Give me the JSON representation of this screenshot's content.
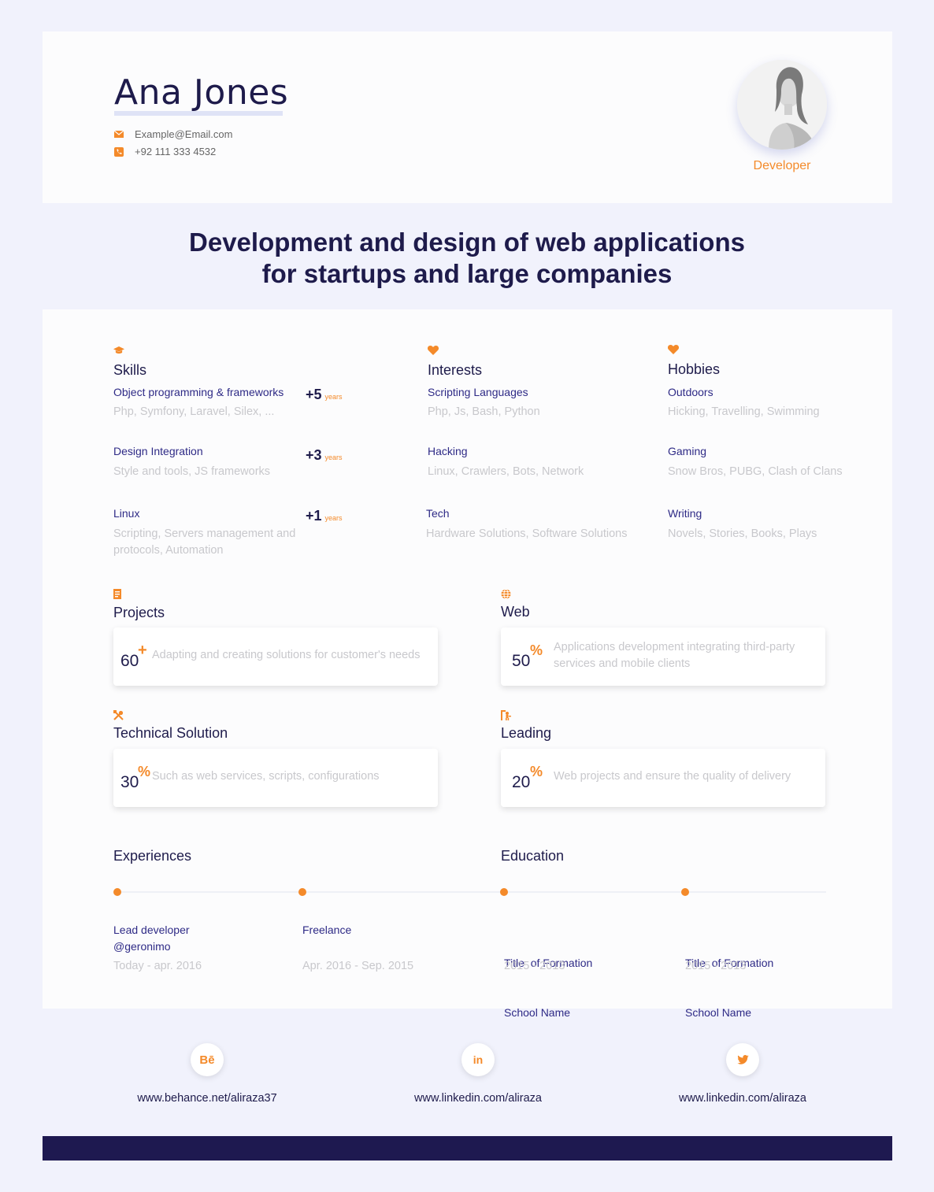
{
  "profile": {
    "name": "Ana Jones",
    "email": "Example@Email.com",
    "phone": "+92 111 333 4532",
    "role": "Developer"
  },
  "tagline": {
    "line1": "Development and design of web applications",
    "line2": "for startups and large companies"
  },
  "skills": {
    "title": "Skills",
    "items": [
      {
        "title": "Object programming & frameworks",
        "desc": "Php, Symfony, Laravel, Silex, ...",
        "years": "+5",
        "years_label": "years"
      },
      {
        "title": "Design Integration",
        "desc": "Style and tools, JS frameworks",
        "years": "+3",
        "years_label": "years"
      },
      {
        "title": "Linux",
        "desc": "Scripting, Servers management and protocols, Automation",
        "years": "+1",
        "years_label": "years"
      }
    ]
  },
  "interests": {
    "title": "Interests",
    "items": [
      {
        "title": "Scripting Languages",
        "desc": "Php, Js, Bash, Python"
      },
      {
        "title": "Hacking",
        "desc": "Linux, Crawlers, Bots, Network"
      },
      {
        "title": "Tech",
        "desc": "Hardware Solutions, Software Solutions"
      }
    ]
  },
  "hobbies": {
    "title": "Hobbies",
    "items": [
      {
        "title": "Outdoors",
        "desc": "Hicking, Travelling, Swimming"
      },
      {
        "title": "Gaming",
        "desc": "Snow Bros, PUBG, Clash of Clans"
      },
      {
        "title": "Writing",
        "desc": "Novels, Stories, Books, Plays"
      }
    ]
  },
  "stats": [
    {
      "title": "Projects",
      "value": "60",
      "symbol": "+",
      "text": "Adapting and creating solutions for customer's needs"
    },
    {
      "title": "Web",
      "value": "50",
      "symbol": "%",
      "text": "Applications development integrating third-party services and mobile clients"
    },
    {
      "title": "Technical Solution",
      "value": "30",
      "symbol": "%",
      "text": "Such as web services, scripts, configurations"
    },
    {
      "title": "Leading",
      "value": "20",
      "symbol": "%",
      "text": "Web projects and ensure the quality of delivery"
    }
  ],
  "experiences": {
    "title": "Experiences",
    "items": [
      {
        "line1": "Lead developer",
        "line2": "@geronimo",
        "date": "Today - apr. 2016"
      },
      {
        "line1": "Freelance",
        "line2": "",
        "date": "Apr. 2016 - Sep. 2015"
      }
    ]
  },
  "education": {
    "title": "Education",
    "items": [
      {
        "line1": "Title  of Formation",
        "line2": "School Name",
        "date": "2015 - 2013"
      },
      {
        "line1": "Title  of Formation",
        "line2": "School Name",
        "date": "2015 - 2013"
      }
    ]
  },
  "social": [
    {
      "icon": "behance-icon",
      "glyph": "Bē",
      "url": "www.behance.net/aliraza37"
    },
    {
      "icon": "linkedin-icon",
      "glyph": "in",
      "url": "www.linkedin.com/aliraza"
    },
    {
      "icon": "twitter-icon",
      "glyph": "",
      "url": "www.linkedin.com/aliraza"
    }
  ],
  "colors": {
    "accent": "#f48a2a",
    "navy": "#1e1b4b",
    "background": "#f1f2fc"
  }
}
